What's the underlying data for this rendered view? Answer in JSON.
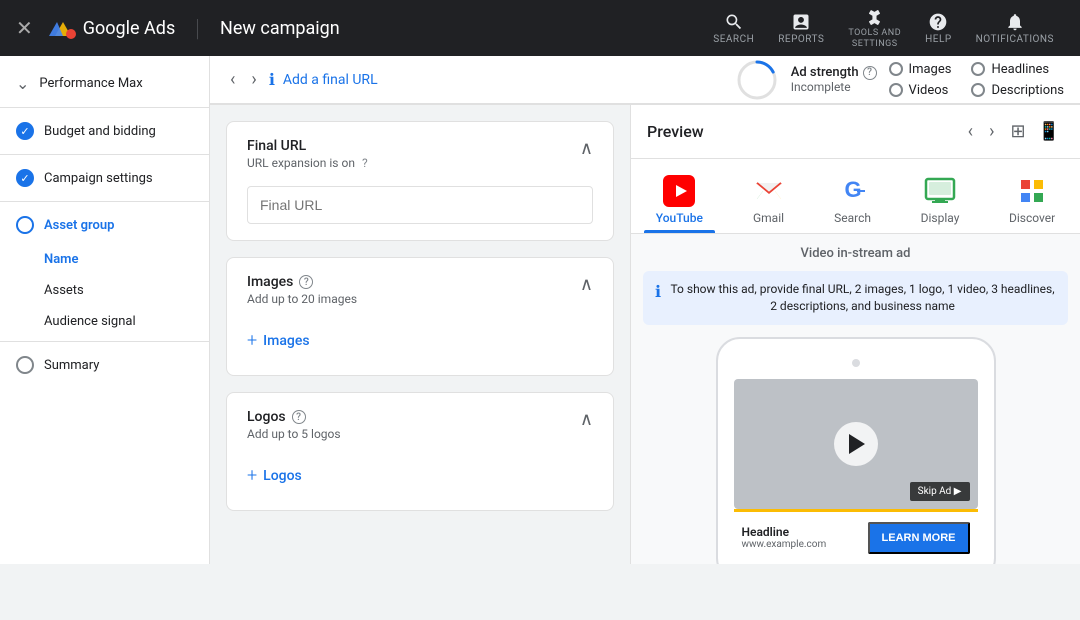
{
  "topNav": {
    "closeLabel": "✕",
    "logoText": "Google Ads",
    "divider": "|",
    "campaignTitle": "New campaign",
    "navItems": [
      {
        "id": "search",
        "label": "SEARCH"
      },
      {
        "id": "reports",
        "label": "REPORTS"
      },
      {
        "id": "tools",
        "label": "TOOLS AND\nSETTINGS"
      },
      {
        "id": "help",
        "label": "HELP"
      },
      {
        "id": "notifications",
        "label": "NOTIFICATIONS"
      }
    ]
  },
  "sidebar": {
    "items": [
      {
        "id": "performance-max",
        "label": "Performance Max",
        "icon": "chevron",
        "type": "section"
      },
      {
        "id": "budget-bidding",
        "label": "Budget and bidding",
        "icon": "check-filled"
      },
      {
        "id": "campaign-settings",
        "label": "Campaign settings",
        "icon": "check-filled"
      },
      {
        "id": "asset-group",
        "label": "Asset group",
        "icon": "circle-empty",
        "active": true
      }
    ],
    "subItems": [
      {
        "id": "name",
        "label": "Name",
        "active": true
      },
      {
        "id": "assets",
        "label": "Assets"
      },
      {
        "id": "audience-signal",
        "label": "Audience signal"
      }
    ],
    "summaryItem": {
      "id": "summary",
      "label": "Summary",
      "icon": "circle-empty"
    }
  },
  "breadcrumb": {
    "backLabel": "‹",
    "forwardLabel": "›",
    "infoIcon": "ℹ",
    "addFinalUrl": "Add a final URL"
  },
  "adStrength": {
    "title": "Ad strength",
    "helpIcon": "?",
    "status": "Incomplete",
    "items": [
      {
        "id": "images",
        "label": "Images"
      },
      {
        "id": "videos",
        "label": "Videos"
      },
      {
        "id": "headlines",
        "label": "Headlines"
      },
      {
        "id": "descriptions",
        "label": "Descriptions"
      }
    ]
  },
  "sections": [
    {
      "id": "final-url",
      "title": "Final URL",
      "subtitle": "URL expansion is on",
      "helpIcon": "?",
      "inputPlaceholder": "Final URL",
      "collapsed": false
    },
    {
      "id": "images",
      "title": "Images",
      "helpIcon": "?",
      "subtitle": "Add up to 20 images",
      "addLabel": "Images",
      "collapsed": false
    },
    {
      "id": "logos",
      "title": "Logos",
      "helpIcon": "?",
      "subtitle": "Add up to 5 logos",
      "addLabel": "Logos",
      "collapsed": false
    }
  ],
  "preview": {
    "title": "Preview",
    "channels": [
      {
        "id": "youtube",
        "label": "YouTube",
        "active": true
      },
      {
        "id": "gmail",
        "label": "Gmail",
        "active": false
      },
      {
        "id": "search",
        "label": "Search",
        "active": false
      },
      {
        "id": "display",
        "label": "Display",
        "active": false
      },
      {
        "id": "discover",
        "label": "Discover",
        "active": false
      }
    ],
    "adType": "Video in-stream ad",
    "infoBannerText": "To show this ad, provide final URL, 2 images, 1 logo, 1 video, 3 headlines, 2 descriptions, and business name",
    "phone": {
      "skipAdLabel": "Skip Ad ▶",
      "adHeadline": "Headline",
      "adUrl": "www.example.com",
      "learnMoreLabel": "LEARN MORE"
    }
  }
}
